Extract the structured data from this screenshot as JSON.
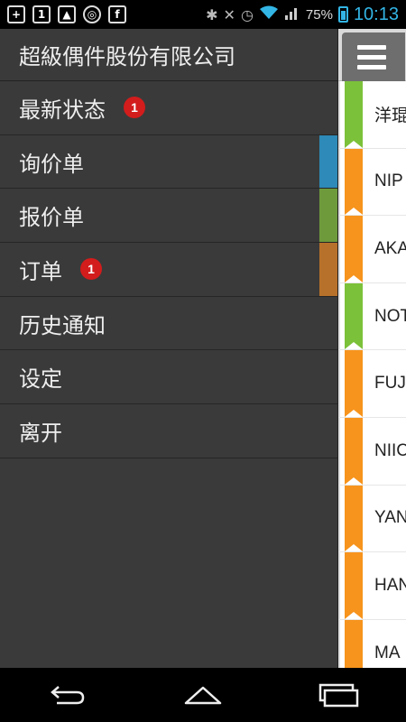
{
  "status_bar": {
    "battery_text": "75%",
    "time": "10:13",
    "left_icons": [
      "plus-icon",
      "one-icon",
      "image-icon",
      "sync-icon",
      "facebook-icon"
    ],
    "left_labels": [
      "+",
      "1",
      "▲",
      "◎",
      "f"
    ]
  },
  "drawer": {
    "title": "超級偶件股份有限公司",
    "items": [
      {
        "label": "最新状态",
        "badge": "1",
        "accent": ""
      },
      {
        "label": "询价单",
        "badge": "",
        "accent": "#2e8ab8"
      },
      {
        "label": "报价单",
        "badge": "",
        "accent": "#6e9a3c"
      },
      {
        "label": "订单",
        "badge": "1",
        "accent": "#b8712a"
      },
      {
        "label": "历史通知",
        "badge": "",
        "accent": ""
      },
      {
        "label": "设定",
        "badge": "",
        "accent": ""
      },
      {
        "label": "离开",
        "badge": "",
        "accent": ""
      }
    ]
  },
  "content": {
    "rows": [
      {
        "text": "洋琨",
        "color": "#7cc13a"
      },
      {
        "text": "NIP",
        "color": "#f7941d"
      },
      {
        "text": "AKA",
        "color": "#f7941d"
      },
      {
        "text": "NOT",
        "color": "#7cc13a"
      },
      {
        "text": "FUJ",
        "color": "#f7941d"
      },
      {
        "text": "NIIC",
        "color": "#f7941d"
      },
      {
        "text": "YAN",
        "color": "#f7941d"
      },
      {
        "text": "HAN",
        "color": "#f7941d"
      },
      {
        "text": "MA",
        "color": "#f7941d"
      }
    ]
  },
  "colors": {
    "drawer_bg": "#3a3a3a",
    "badge": "#d31c1c",
    "status_accent": "#33b5e5"
  }
}
